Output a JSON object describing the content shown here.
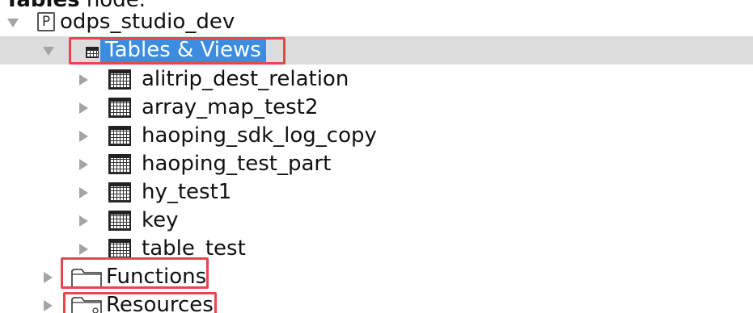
{
  "caption": {
    "bold": "Tables",
    "rest": " node."
  },
  "tree": {
    "project": {
      "label": "odps_studio_dev",
      "icon_letter": "P",
      "expanded": true
    },
    "tables_views": {
      "label": "Tables & Views",
      "expanded": true,
      "selected": true,
      "tables": [
        "alitrip_dest_relation",
        "array_map_test2",
        "haoping_sdk_log_copy",
        "haoping_test_part",
        "hy_test1",
        "key",
        "table_test"
      ]
    },
    "functions": {
      "label": "Functions",
      "expanded": false
    },
    "resources": {
      "label": "Resources",
      "expanded": false
    }
  },
  "colors": {
    "selection_row": "#dcdcdc",
    "label_highlight": "#3c8ce0",
    "annotation": "#e8464f",
    "arrow": "#a4a4a4"
  },
  "icons": {
    "project": "project-icon",
    "tables_views": "table-grid-icon",
    "table": "table-grid-icon",
    "functions": "folder-icon",
    "resources": "resource-folder-icon"
  }
}
